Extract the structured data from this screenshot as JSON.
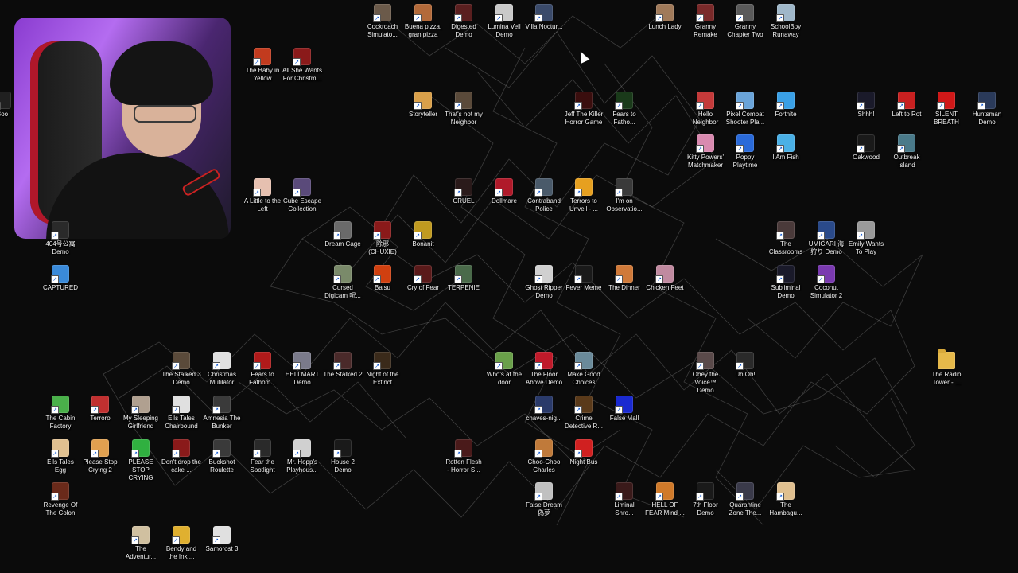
{
  "desktop": {
    "icons": [
      {
        "label": "Cockroach Simulato...",
        "color": "#6b5a4a"
      },
      {
        "label": "Buena pizza, gran pizza",
        "color": "#b36a3a"
      },
      {
        "label": "Digested Demo",
        "color": "#5a1f1f"
      },
      {
        "label": "Lumina Veil Demo",
        "color": "#c9c9c9"
      },
      {
        "label": "Villa Noctur...",
        "color": "#3a4a6a"
      },
      {
        "label": "Lunch Lady",
        "color": "#a07a5a"
      },
      {
        "label": "Granny Remake",
        "color": "#7a2a2a"
      },
      {
        "label": "Granny Chapter Two",
        "color": "#5a5a5a"
      },
      {
        "label": "SchoolBoy Runaway",
        "color": "#9fb7c9"
      },
      {
        "label": "The Baby in Yellow",
        "color": "#c23b1e"
      },
      {
        "label": "All She Wants For Christm...",
        "color": "#8a1a1a"
      },
      {
        "label": "Storyteller",
        "color": "#d9a04a"
      },
      {
        "label": "That's not my Neighbor",
        "color": "#5a4a3a"
      },
      {
        "label": "Jeff The Killer Horror Game",
        "color": "#3a0e0e"
      },
      {
        "label": "Fears to Fatho...",
        "color": "#1a3a1a"
      },
      {
        "label": "Hello Neighbor",
        "color": "#c43a3a"
      },
      {
        "label": "Pixel Combat Shooter Pla...",
        "color": "#6aa4d9"
      },
      {
        "label": "Fortnite",
        "color": "#3aa0e6"
      },
      {
        "label": "Shhh!",
        "color": "#1a1a2a"
      },
      {
        "label": "Left to Rot",
        "color": "#c82020"
      },
      {
        "label": "SILENT BREATH",
        "color": "#d01818"
      },
      {
        "label": "Huntsman Demo",
        "color": "#2a3a5a"
      },
      {
        "label": "Kitty Powers' Matchmaker",
        "color": "#d98ab0"
      },
      {
        "label": "Poppy Playtime",
        "color": "#2a6ad9"
      },
      {
        "label": "I Am Fish",
        "color": "#4ab0e6"
      },
      {
        "label": "Oakwood",
        "color": "#1a1a1a"
      },
      {
        "label": "Outbreak Island",
        "color": "#4a7a8a"
      },
      {
        "label": "A Little to the Left",
        "color": "#e6c0b0"
      },
      {
        "label": "Cube Escape Collection",
        "color": "#5a4a7a"
      },
      {
        "label": "CRUEL",
        "color": "#2a1a1a"
      },
      {
        "label": "Dollmare",
        "color": "#b01a2a"
      },
      {
        "label": "Contraband Police",
        "color": "#4a5a6a"
      },
      {
        "label": "Terrors to Unveil - ...",
        "color": "#e6a020"
      },
      {
        "label": "I'm on Observatio...",
        "color": "#3a3a3a"
      },
      {
        "label": "404号公寓 Demo",
        "color": "#2a2a2a"
      },
      {
        "label": "CAPTURED",
        "color": "#3a8ad9"
      },
      {
        "label": "Dream Cage",
        "color": "#6a6a6a"
      },
      {
        "label": "除邪 (CHUXIE)",
        "color": "#8a1a1a"
      },
      {
        "label": "Bonanit",
        "color": "#c09a20"
      },
      {
        "label": "The Classrooms",
        "color": "#4a3a3a"
      },
      {
        "label": "UMIGARI 海狩り Demo",
        "color": "#2a4a8a"
      },
      {
        "label": "Emily Wants To Play",
        "color": "#9a9a9a"
      },
      {
        "label": "Cursed Digicam 呪...",
        "color": "#7a8a6a"
      },
      {
        "label": "Baisu",
        "color": "#d04010"
      },
      {
        "label": "Cry of Fear",
        "color": "#5a1a1a"
      },
      {
        "label": "TERPENIE",
        "color": "#4a6a4a"
      },
      {
        "label": "Ghost Ripper Demo",
        "color": "#d0d0d0"
      },
      {
        "label": "Fever Meme",
        "color": "#1a1a1a"
      },
      {
        "label": "The Dinner",
        "color": "#d07a3a"
      },
      {
        "label": "Chicken Feet",
        "color": "#c08aa0"
      },
      {
        "label": "Subliminal Demo",
        "color": "#1a1a2a"
      },
      {
        "label": "Coconut Simulator 2",
        "color": "#7a3ab0"
      },
      {
        "label": "The Stalked 3 Demo",
        "color": "#5a4a3a"
      },
      {
        "label": "Christmas Mutilator",
        "color": "#e0e0e0"
      },
      {
        "label": "Fears to Fathom...",
        "color": "#b01a1a"
      },
      {
        "label": "HELLMART Demo",
        "color": "#7a7a8a"
      },
      {
        "label": "The Stalked 2",
        "color": "#4a2a2a"
      },
      {
        "label": "Night of the Extinct",
        "color": "#3a2a1a"
      },
      {
        "label": "Who's at the door",
        "color": "#6aa04a"
      },
      {
        "label": "The Floor Above Demo",
        "color": "#c01a2a"
      },
      {
        "label": "Make Good Choices",
        "color": "#6a8a9a"
      },
      {
        "label": "Obey the Voice™ Demo",
        "color": "#5a4a4a"
      },
      {
        "label": "Uh Oh!",
        "color": "#2a2a2a"
      },
      {
        "label": "The Radio Tower - ...",
        "color": "#e6b94a"
      },
      {
        "label": "The Cabin Factory",
        "color": "#4ab04a"
      },
      {
        "label": "Terroro",
        "color": "#c03030"
      },
      {
        "label": "My Sleeping Girlfriend",
        "color": "#b0a090"
      },
      {
        "label": "Ells Tales Chairbound",
        "color": "#e0e0e0"
      },
      {
        "label": "Amnesia The Bunker",
        "color": "#3a3a3a"
      },
      {
        "label": "chaves-nig...",
        "color": "#2a3a6a"
      },
      {
        "label": "Crime Detective R...",
        "color": "#5a3a1a"
      },
      {
        "label": "False Mall",
        "color": "#1a2ad0"
      },
      {
        "label": "Ells Tales Egg",
        "color": "#e0c090"
      },
      {
        "label": "Please Stop Crying 2",
        "color": "#e0a050"
      },
      {
        "label": "PLEASE STOP CRYING",
        "color": "#30b040"
      },
      {
        "label": "Don't drop the cake ...",
        "color": "#8a1a1a"
      },
      {
        "label": "Buckshot Roulette",
        "color": "#3a3a3a"
      },
      {
        "label": "Fear the Spotlight",
        "color": "#2a2a2a"
      },
      {
        "label": "Mr. Hopp's Playhous...",
        "color": "#d0d0d0"
      },
      {
        "label": "House 2 Demo",
        "color": "#1a1a1a"
      },
      {
        "label": "Rotten Flesh - Horror S...",
        "color": "#4a1a1a"
      },
      {
        "label": "Choo-Choo Charles",
        "color": "#c07a3a"
      },
      {
        "label": "Night Bus",
        "color": "#d02020"
      },
      {
        "label": "Revenge Of The Colon",
        "color": "#6a2a1a"
      },
      {
        "label": "False Dream 偽夢",
        "color": "#c0c0c0"
      },
      {
        "label": "Liminal Shro...",
        "color": "#3a1a1a"
      },
      {
        "label": "HELL OF FEAR Mind ...",
        "color": "#d07a2a"
      },
      {
        "label": "7th Floor Demo",
        "color": "#1a1a1a"
      },
      {
        "label": "Quarantine Zone The...",
        "color": "#3a3a4a"
      },
      {
        "label": "The Hambagu...",
        "color": "#e0c090"
      },
      {
        "label": "The Adventur...",
        "color": "#d0c0a0"
      },
      {
        "label": "Bendy and the Ink ...",
        "color": "#e0b030"
      },
      {
        "label": "Samorost 3",
        "color": "#e0e0e0"
      },
      {
        "label": "Boo",
        "color": "#202020"
      }
    ]
  }
}
